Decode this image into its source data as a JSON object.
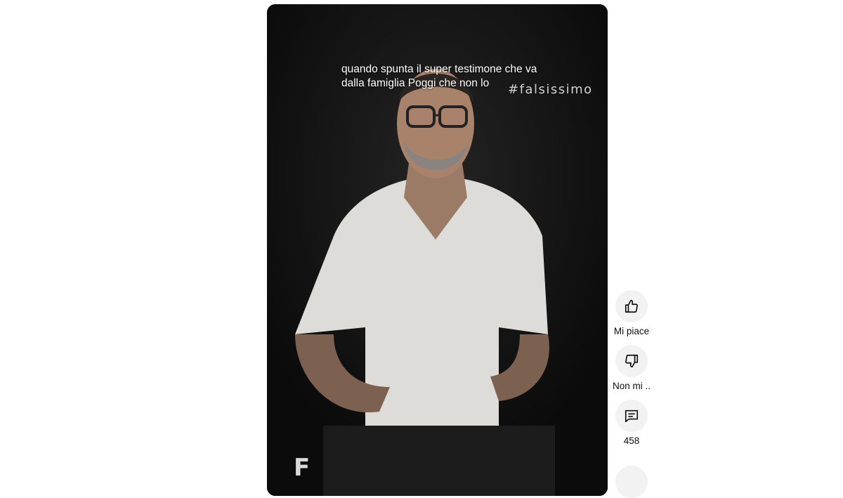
{
  "video": {
    "caption_lines": [
      "quando spunta il super testimone che va",
      "dalla famiglia Poggi che non lo"
    ],
    "hashtag": "#falsissimo",
    "watermark": "F"
  },
  "actions": {
    "like": {
      "label": "Mi piace",
      "icon": "thumbs-up-icon"
    },
    "dislike": {
      "label": "Non mi ..",
      "icon": "thumbs-down-icon"
    },
    "comments": {
      "label": "458",
      "icon": "comment-icon"
    }
  }
}
